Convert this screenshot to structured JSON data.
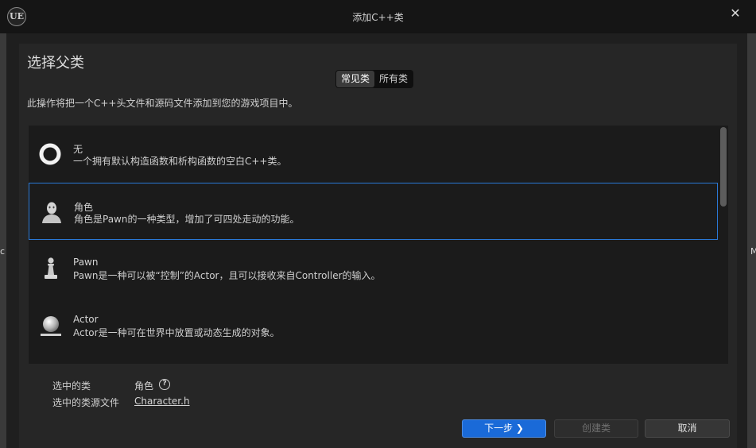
{
  "window": {
    "title": "添加C++类",
    "logo": "UE",
    "close_icon": "✕"
  },
  "background_fragments": {
    "left": "c",
    "right": "M"
  },
  "page": {
    "heading": "选择父类",
    "tabs": [
      {
        "label": "常见类",
        "active": true
      },
      {
        "label": "所有类",
        "active": false
      }
    ],
    "description": "此操作将把一个C++头文件和源码文件添加到您的游戏项目中。"
  },
  "class_list": [
    {
      "name": "无",
      "desc": "一个拥有默认构造函数和析构函数的空白C++类。",
      "icon": "ring-icon",
      "selected": false
    },
    {
      "name": "角色",
      "desc": "角色是Pawn的一种类型，增加了可四处走动的功能。",
      "icon": "character-icon",
      "selected": true
    },
    {
      "name": "Pawn",
      "desc": "Pawn是一种可以被“控制”的Actor，且可以接收来自Controller的输入。",
      "icon": "pawn-icon",
      "selected": false
    },
    {
      "name": "Actor",
      "desc": "Actor是一种可在世界中放置或动态生成的对象。",
      "icon": "sphere-icon",
      "selected": false
    }
  ],
  "selection_info": {
    "class_label": "选中的类",
    "class_value": "角色",
    "source_label": "选中的类源文件",
    "source_value": "Character.h",
    "help_icon": "?"
  },
  "buttons": {
    "next": "下一步 ❯",
    "create": "创建类",
    "cancel": "取消"
  },
  "colors": {
    "accent": "#1a6ad8",
    "selection_border": "#2a78d6",
    "panel": "#262626"
  }
}
